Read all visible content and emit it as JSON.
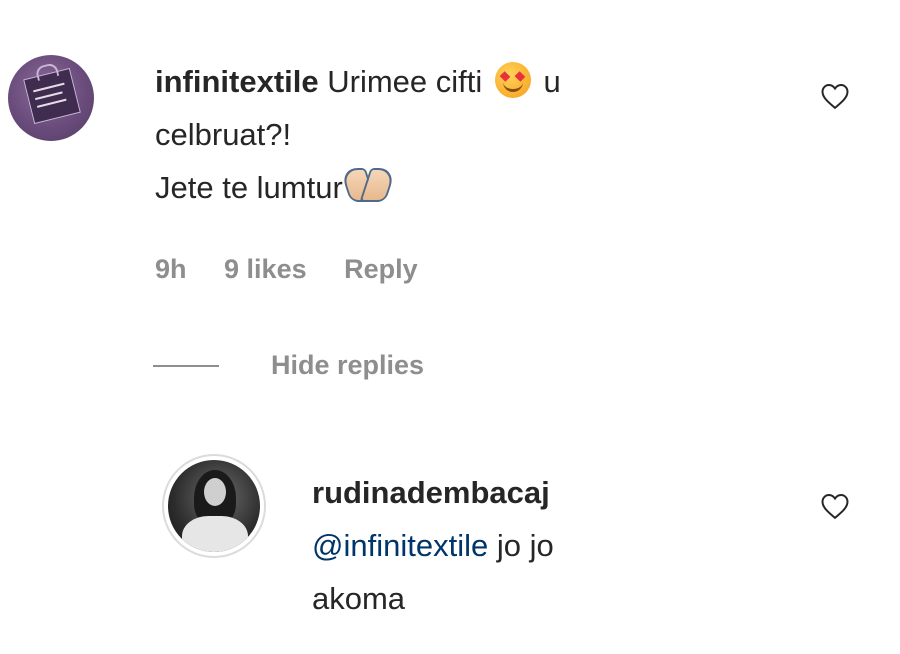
{
  "comment": {
    "username": "infinitextile",
    "text_part1": "Urimee cifti",
    "emoji_1": "smiling-face-with-hearts",
    "text_part2": "u",
    "line2": "celbruat?!",
    "line3": "Jete te lumtur",
    "emoji_2": "folded-hands",
    "time": "9h",
    "likes": "9 likes",
    "reply_label": "Reply"
  },
  "hide_replies_label": "Hide replies",
  "reply": {
    "username": "rudinadembacaj",
    "mention": "@infinitextile",
    "text_part1": "jo jo",
    "line2": "akoma"
  },
  "colors": {
    "text": "#262626",
    "secondary": "#8e8e8e",
    "mention": "#003569"
  }
}
